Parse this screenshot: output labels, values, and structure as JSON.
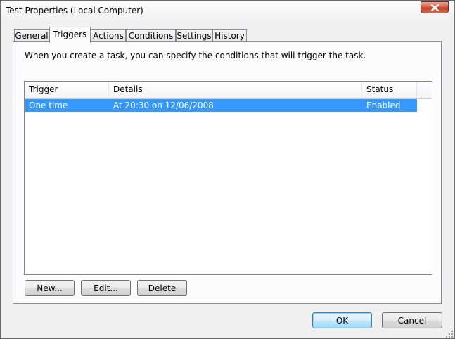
{
  "window": {
    "title": "Test Properties (Local Computer)"
  },
  "tabs": [
    {
      "label": "General"
    },
    {
      "label": "Triggers"
    },
    {
      "label": "Actions"
    },
    {
      "label": "Conditions"
    },
    {
      "label": "Settings"
    },
    {
      "label": "History"
    }
  ],
  "selected_tab": "Triggers",
  "triggers_tab": {
    "description": "When you create a task, you can specify the conditions that will trigger the task.",
    "columns": [
      "Trigger",
      "Details",
      "Status"
    ],
    "rows": [
      {
        "trigger": "One time",
        "details": "At 20:30 on 12/06/2008",
        "status": "Enabled",
        "selected": true
      }
    ],
    "buttons": {
      "new": "New...",
      "edit": "Edit...",
      "delete": "Delete"
    }
  },
  "footer": {
    "ok": "OK",
    "cancel": "Cancel"
  },
  "colors": {
    "selection": "#3399ff",
    "close_button": "#c23d26",
    "window_bg": "#f0f0f0"
  },
  "icons": [
    "close-icon",
    "resize-grip-icon"
  ]
}
